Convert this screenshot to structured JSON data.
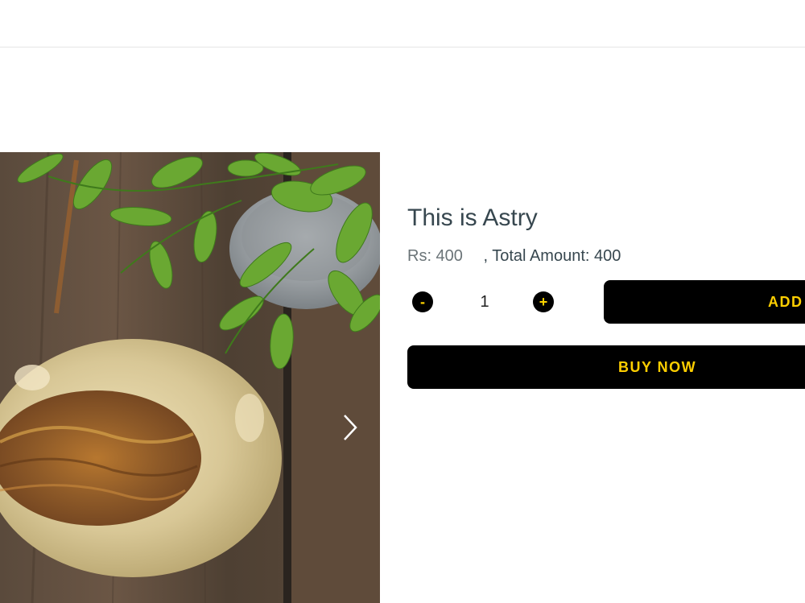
{
  "product": {
    "title": "This is Astry",
    "price_text": "Rs: 400",
    "total_text": ", Total Amount: 400"
  },
  "quantity": {
    "minus_label": "-",
    "value": "1",
    "plus_label": "+"
  },
  "actions": {
    "add_to_cart_label": "ADD TO CART",
    "buy_now_label": "BUY NOW"
  },
  "gallery": {
    "image_subject": "onyx ashtray on wooden table with green plant",
    "next_icon": "chevron-right-icon"
  },
  "colors": {
    "button_bg": "#000000",
    "button_text": "#ffcf00",
    "title_text": "#37474f"
  }
}
